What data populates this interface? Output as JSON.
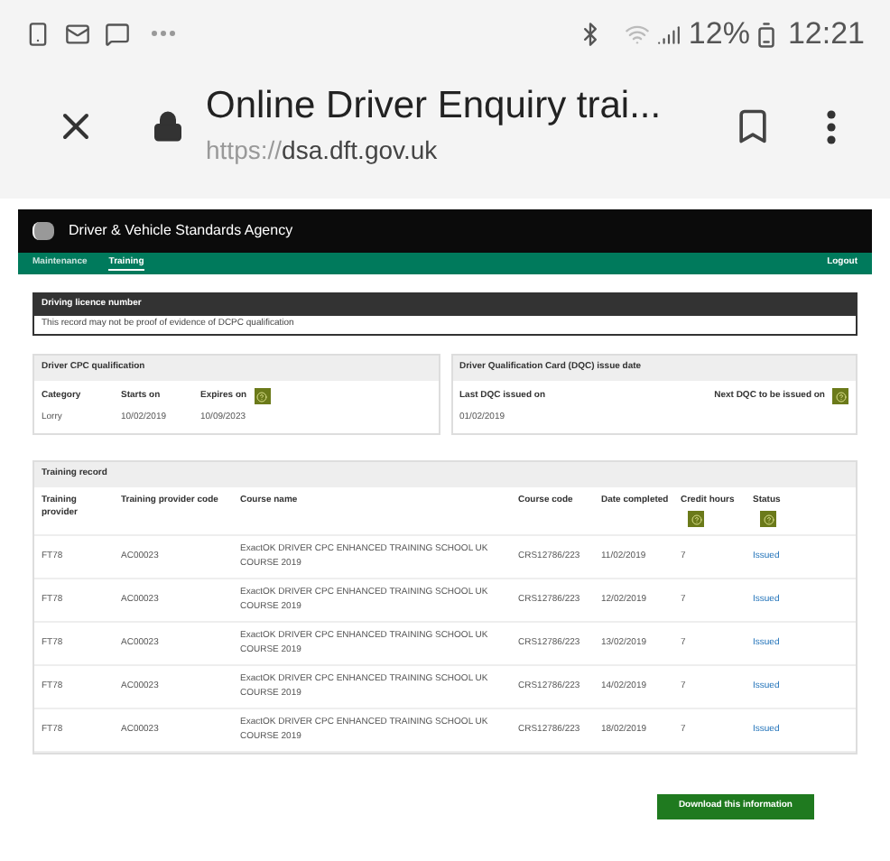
{
  "status_bar": {
    "battery": "12%",
    "time": "12:21"
  },
  "browser": {
    "title": "Online Driver Enquiry trai...",
    "url_scheme": "https://",
    "url_host": "dsa.dft.gov.uk"
  },
  "site": {
    "agency": "Driver & Vehicle Standards Agency",
    "nav": [
      {
        "label": "Maintenance",
        "selected": false
      },
      {
        "label": "Training",
        "selected": true
      }
    ],
    "logout": "Logout"
  },
  "licence_panel": {
    "title": "Driving licence number",
    "message": "This record may not be proof of evidence of DCPC qualification"
  },
  "cpc_panel": {
    "title": "Driver CPC qualification",
    "columns": [
      "Category",
      "Starts on",
      "Expires on"
    ],
    "row": [
      "Lorry",
      "10/02/2019",
      "10/09/2023"
    ]
  },
  "dqc_panel": {
    "title": "Driver Qualification Card (DQC) issue date",
    "columns": [
      "Last DQC issued on",
      "Next DQC to be issued on"
    ],
    "row": [
      "01/02/2019"
    ]
  },
  "training": {
    "title": "Training record",
    "columns": [
      "Training provider",
      "Training provider code",
      "Course name",
      "Course code",
      "Date completed",
      "Credit hours",
      "Status"
    ],
    "rows": [
      [
        "FT78",
        "AC00023",
        "ExactOK DRIVER CPC ENHANCED TRAINING SCHOOL UK COURSE 2019",
        "CRS12786/223",
        "11/02/2019",
        "7",
        "Issued"
      ],
      [
        "FT78",
        "AC00023",
        "ExactOK DRIVER CPC ENHANCED TRAINING SCHOOL UK COURSE 2019",
        "CRS12786/223",
        "12/02/2019",
        "7",
        "Issued"
      ],
      [
        "FT78",
        "AC00023",
        "ExactOK DRIVER CPC ENHANCED TRAINING SCHOOL UK COURSE 2019",
        "CRS12786/223",
        "13/02/2019",
        "7",
        "Issued"
      ],
      [
        "FT78",
        "AC00023",
        "ExactOK DRIVER CPC ENHANCED TRAINING SCHOOL UK COURSE 2019",
        "CRS12786/223",
        "14/02/2019",
        "7",
        "Issued"
      ],
      [
        "FT78",
        "AC00023",
        "ExactOK DRIVER CPC ENHANCED TRAINING SCHOOL UK COURSE 2019",
        "CRS12786/223",
        "18/02/2019",
        "7",
        "Issued"
      ]
    ]
  },
  "download_button": "Download this information"
}
